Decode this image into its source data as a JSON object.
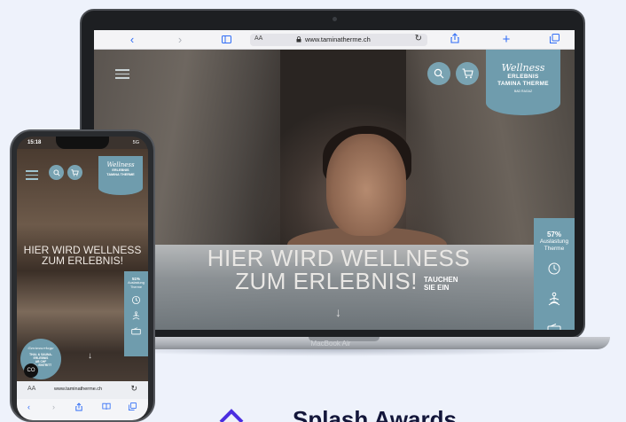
{
  "laptop": {
    "model_label": "MacBook Air",
    "browser": {
      "reader_label": "AA",
      "url": "www.taminatherme.ch"
    },
    "site": {
      "brand": {
        "script": "Wellness",
        "line1": "ERLEBNIS",
        "line2": "TAMINA THERME",
        "line3": "BAD RAGAZ"
      },
      "headline_line1": "HIER WIRD WELLNESS",
      "headline_line2": "ZUM ERLEBNIS!",
      "subline_line1": "TAUCHEN",
      "subline_line2": "SIE EIN",
      "occupancy": {
        "percent": "57%",
        "label_line1": "Auslastung",
        "label_line2": "Therme"
      }
    }
  },
  "phone": {
    "status_time": "15:18",
    "status_signal": "5G",
    "site": {
      "brand": {
        "script": "Wellness",
        "line1": "ERLEBNIS",
        "line2": "TAMINA THERME"
      },
      "headline_line1": "HIER WIRD WELLNESS",
      "headline_line2": "ZUM ERLEBNIS!",
      "occupancy": {
        "percent": "51%",
        "label_line1": "Auslastung",
        "label_line2": "Therme"
      },
      "promo": {
        "script": "Geniessertage",
        "line1": "THAI- & SAUNA-",
        "line2": "ERLEBNIS",
        "line3": "AB CHF",
        "line4": "INKL. EINTRITT"
      },
      "cookie_label": "CO"
    },
    "browser": {
      "reader_label": "AA",
      "url": "www.taminatherme.ch"
    }
  },
  "awards": {
    "title": "Splash Awards"
  },
  "colors": {
    "brand_teal": "#6f9cad",
    "background": "#eef2fb",
    "safari_blue": "#2f6df6",
    "awards_purple": "#4b2ee0"
  }
}
